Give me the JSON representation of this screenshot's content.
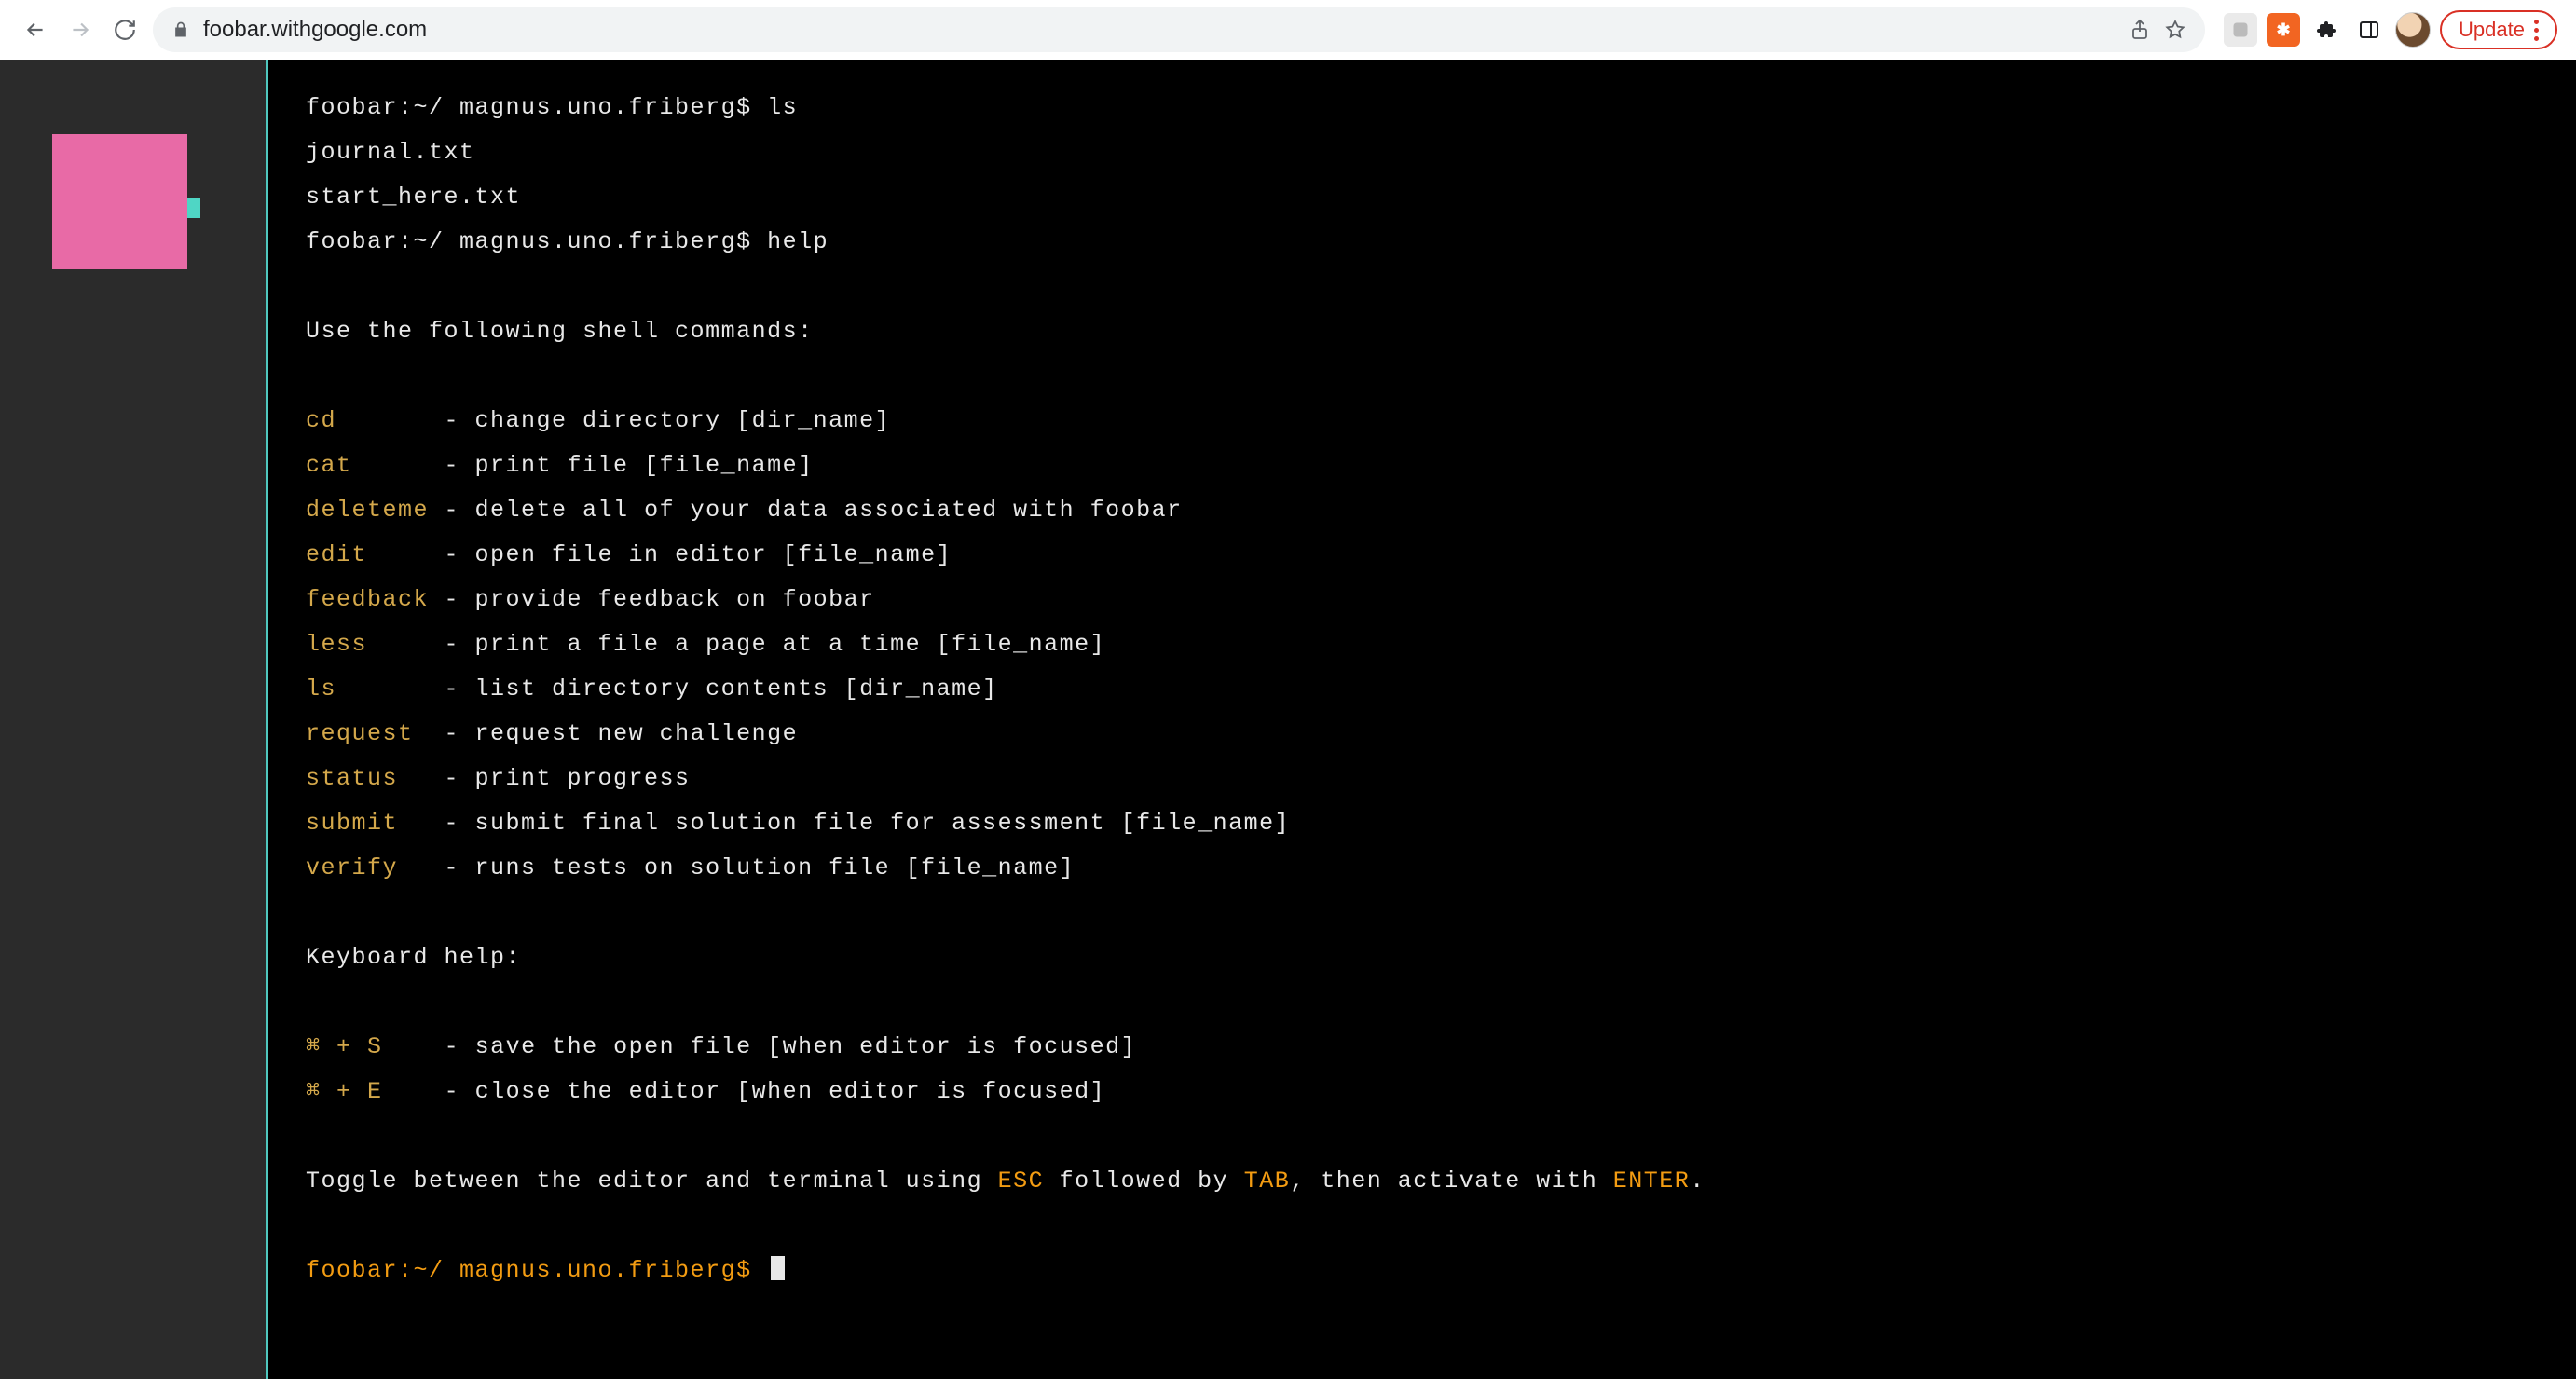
{
  "browser": {
    "url": "foobar.withgoogle.com",
    "update_label": "Update"
  },
  "terminal": {
    "prompt": "foobar:~/ magnus.uno.friberg$",
    "history": [
      {
        "cmd": "ls"
      },
      {
        "cmd": "help"
      }
    ],
    "files": [
      "journal.txt",
      "start_here.txt"
    ],
    "help_heading": "Use the following shell commands:",
    "commands": [
      {
        "name": "cd",
        "desc": "change directory [dir_name]"
      },
      {
        "name": "cat",
        "desc": "print file [file_name]"
      },
      {
        "name": "deleteme",
        "desc": "delete all of your data associated with foobar"
      },
      {
        "name": "edit",
        "desc": "open file in editor [file_name]"
      },
      {
        "name": "feedback",
        "desc": "provide feedback on foobar"
      },
      {
        "name": "less",
        "desc": "print a file a page at a time [file_name]"
      },
      {
        "name": "ls",
        "desc": "list directory contents [dir_name]"
      },
      {
        "name": "request",
        "desc": "request new challenge"
      },
      {
        "name": "status",
        "desc": "print progress"
      },
      {
        "name": "submit",
        "desc": "submit final solution file for assessment [file_name]"
      },
      {
        "name": "verify",
        "desc": "runs tests on solution file [file_name]"
      }
    ],
    "keyboard_heading": "Keyboard help:",
    "keyboard": [
      {
        "combo": "⌘ + S",
        "desc": "save the open file [when editor is focused]"
      },
      {
        "combo": "⌘ + E",
        "desc": "close the editor [when editor is focused]"
      }
    ],
    "toggle_line": {
      "pre": "Toggle between the editor and terminal using ",
      "k1": "ESC",
      "mid1": " followed by ",
      "k2": "TAB",
      "mid2": ", then activate with ",
      "k3": "ENTER",
      "post": "."
    }
  }
}
